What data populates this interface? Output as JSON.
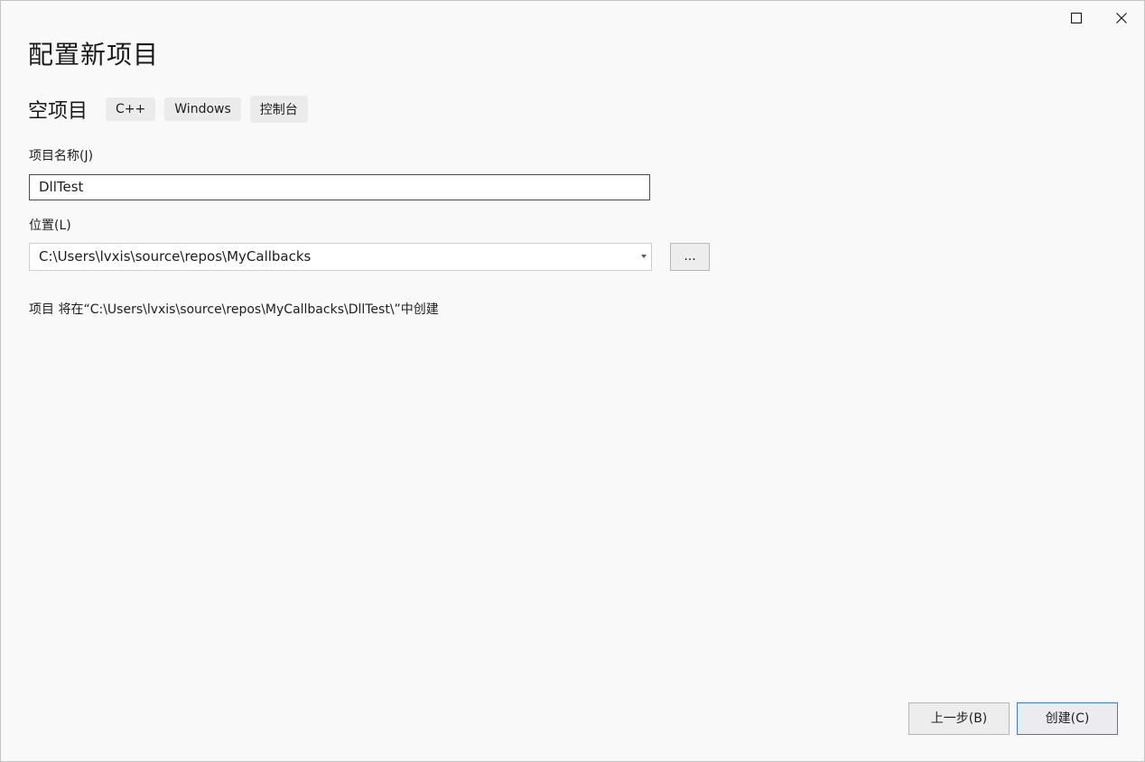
{
  "window": {
    "controls": {
      "maximize_icon": "maximize-icon",
      "close_icon": "close-icon"
    }
  },
  "header": {
    "title": "配置新项目"
  },
  "template": {
    "name": "空项目",
    "tags": [
      "C++",
      "Windows",
      "控制台"
    ]
  },
  "form": {
    "project_name_label": "项目名称(J)",
    "project_name_value": "DllTest",
    "location_label": "位置(L)",
    "location_value": "C:\\Users\\lvxis\\source\\repos\\MyCallbacks",
    "browse_label": "...",
    "create_path_text": "项目 将在“C:\\Users\\lvxis\\source\\repos\\MyCallbacks\\DllTest\\”中创建"
  },
  "footer": {
    "back_label": "上一步(B)",
    "create_label": "创建(C)"
  },
  "colors": {
    "background": "#f9f9fa",
    "tag_background": "#ebebeb",
    "primary_border": "#3c7fc8"
  }
}
